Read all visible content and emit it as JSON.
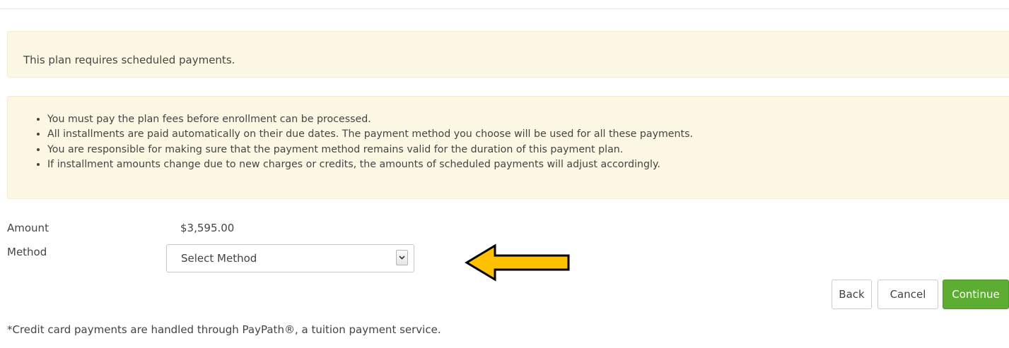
{
  "notice": {
    "text": "This plan requires scheduled payments."
  },
  "rules": [
    "You must pay the plan fees before enrollment can be processed.",
    "All installments are paid automatically on their due dates. The payment method you choose will be used for all these payments.",
    "You are responsible for making sure that the payment method remains valid for the duration of this payment plan.",
    "If installment amounts change due to new charges or credits, the amounts of scheduled payments will adjust accordingly."
  ],
  "form": {
    "amount_label": "Amount",
    "amount_value": "$3,595.00",
    "method_label": "Method",
    "method_selected": "Select Method"
  },
  "buttons": {
    "back": "Back",
    "cancel": "Cancel",
    "continue": "Continue"
  },
  "footnote": "*Credit card payments are handled through PayPath®, a tuition payment service.",
  "annotation": {
    "icon": "arrow-left-icon",
    "fill": "#ffc000",
    "stroke": "#000000"
  },
  "colors": {
    "alert_bg": "#fcf8e3",
    "primary_button": "#5cad32"
  }
}
